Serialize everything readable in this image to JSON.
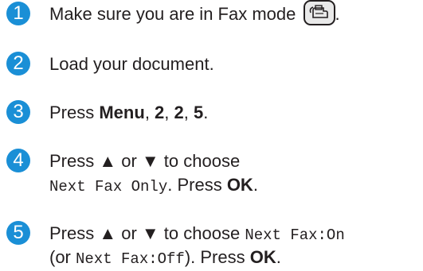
{
  "steps": [
    {
      "number": "1",
      "text_before": "Make sure you are in Fax mode",
      "icon": "fax-mode-button-icon",
      "text_after": "."
    },
    {
      "number": "2",
      "text": "Load your document."
    },
    {
      "number": "3",
      "press": "Press ",
      "key_menu": "Menu",
      "sep1": ", ",
      "key_a": "2",
      "sep2": ", ",
      "key_b": "2",
      "sep3": ", ",
      "key_c": "5",
      "end": "."
    },
    {
      "number": "4",
      "line1": "Press ▲ or ▼ to choose",
      "option": "Next Fax Only",
      "mid": ". Press ",
      "ok": "OK",
      "end": "."
    },
    {
      "number": "5",
      "lead": "Press ▲ or ▼ to choose ",
      "option_on": "Next Fax:On",
      "paren_open": "(or ",
      "option_off": "Next Fax:Off",
      "mid": "). Press ",
      "ok": "OK",
      "end": "."
    }
  ],
  "colors": {
    "step_circle": "#1a8fd6",
    "text": "#231f20"
  }
}
